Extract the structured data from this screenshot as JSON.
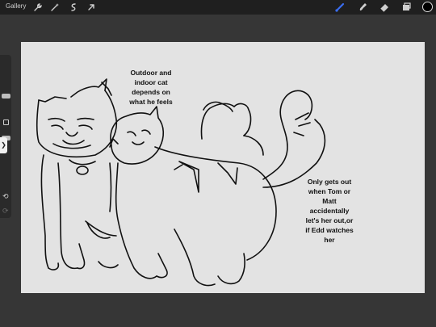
{
  "toolbar": {
    "gallery_label": "Gallery",
    "left_tools": [
      {
        "name": "wrench-icon"
      },
      {
        "name": "magic-wand-icon"
      },
      {
        "name": "selection-icon"
      },
      {
        "name": "transform-arrow-icon"
      }
    ],
    "right_tools": [
      {
        "name": "brush-icon",
        "active": true
      },
      {
        "name": "smudge-icon"
      },
      {
        "name": "eraser-icon"
      },
      {
        "name": "layers-icon"
      }
    ],
    "active_color": "#000000",
    "accent_color": "#3a6df0"
  },
  "sidebar": {
    "undo_icon": "undo-icon",
    "redo_icon": "redo-icon",
    "tab_glyph": "❯"
  },
  "canvas": {
    "note_top": "Outdoor and\nindoor cat\ndepends on\nwhat he feels",
    "note_right": "Only gets out\nwhen Tom or\nMatt\naccidentally\nlet's her out,or\nif Edd watches\nher"
  }
}
